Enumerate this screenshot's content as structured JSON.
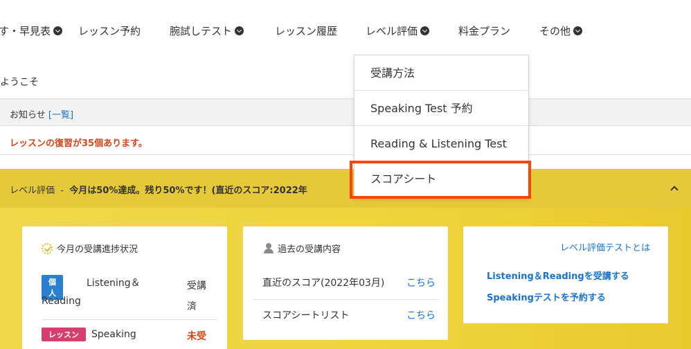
{
  "nav": {
    "items": [
      {
        "label": "す・早見表",
        "has_menu": true
      },
      {
        "label": "レッスン予約",
        "has_menu": false
      },
      {
        "label": "腕試しテスト",
        "has_menu": true
      },
      {
        "label": "レッスン履歴",
        "has_menu": false
      },
      {
        "label": "レベル評価",
        "has_menu": true
      },
      {
        "label": "料金プラン",
        "has_menu": false
      },
      {
        "label": "その他",
        "has_menu": true
      }
    ]
  },
  "welcome": "ようこそ",
  "notice": {
    "title": "お知らせ",
    "link": "[一覧]",
    "message": "レッスンの復習が35個あります。"
  },
  "level": {
    "label": "レベル評価",
    "separator": "-",
    "summary": "今月は50%達成。残り50%です！(直近のスコア:2022年"
  },
  "progress_card": {
    "title": "今月の受講進捗状況",
    "rows": [
      {
        "badge": "個人",
        "name_line1": "Listening＆",
        "name_line2": "Reading",
        "status_line1": "受講",
        "status_line2": "済"
      },
      {
        "badge": "レッスン",
        "name_line1": "Speaking",
        "status_line1": "未受"
      }
    ]
  },
  "history_card": {
    "title": "過去の受講内容",
    "rows": [
      {
        "label": "直近のスコア(2022年03月)",
        "link": "こちら"
      },
      {
        "label": "スコアシートリスト",
        "link": "こちら"
      }
    ]
  },
  "about_card": {
    "title": "レベル評価テストとは",
    "links": [
      "Listening＆Readingを受講する",
      "Speakingテストを予約する"
    ]
  },
  "dropdown": {
    "items": [
      "受講方法",
      "Speaking Test 予約",
      "Reading & Listening Test",
      "スコアシート"
    ]
  },
  "colors": {
    "accent_yellow": "#e6c93a",
    "link_blue": "#1a73c8",
    "alert_red": "#d2461c",
    "highlight": "#ff4500"
  }
}
